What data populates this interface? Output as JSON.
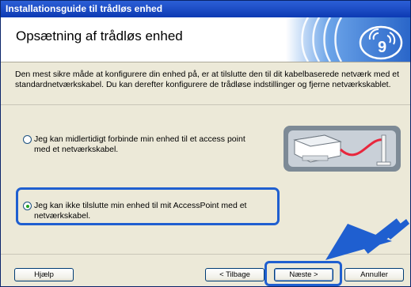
{
  "window": {
    "title": "Installationsguide til trådløs enhed"
  },
  "header": {
    "title": "Opsætning af trådløs enhed",
    "logo_icon": "wireless-signal-icon"
  },
  "intro": {
    "text": "Den mest sikre måde at konfigurere din enhed på, er at tilslutte den til dit kabelbaserede netværk med et standardnetværkskabel. Du kan derefter konfigurere de trådløse indstillinger og fjerne netværkskablet."
  },
  "options": [
    {
      "label": "Jeg kan midlertidigt forbinde min enhed til et access point med et netværkskabel.",
      "selected": false
    },
    {
      "label": "Jeg kan ikke tilslutte min enhed til mit AccessPoint med et netværkskabel.",
      "selected": true
    }
  ],
  "buttons": {
    "help": "Hjælp",
    "back": "< Tilbage",
    "next": "Næste >",
    "cancel": "Annuller"
  },
  "colors": {
    "title_bar": "#1f4fc7",
    "highlight": "#1f5fd0",
    "arrow": "#1f5fd0",
    "cable": "#e8273d",
    "radio_dot": "#21a121",
    "dialog_bg": "#ece9d8"
  }
}
